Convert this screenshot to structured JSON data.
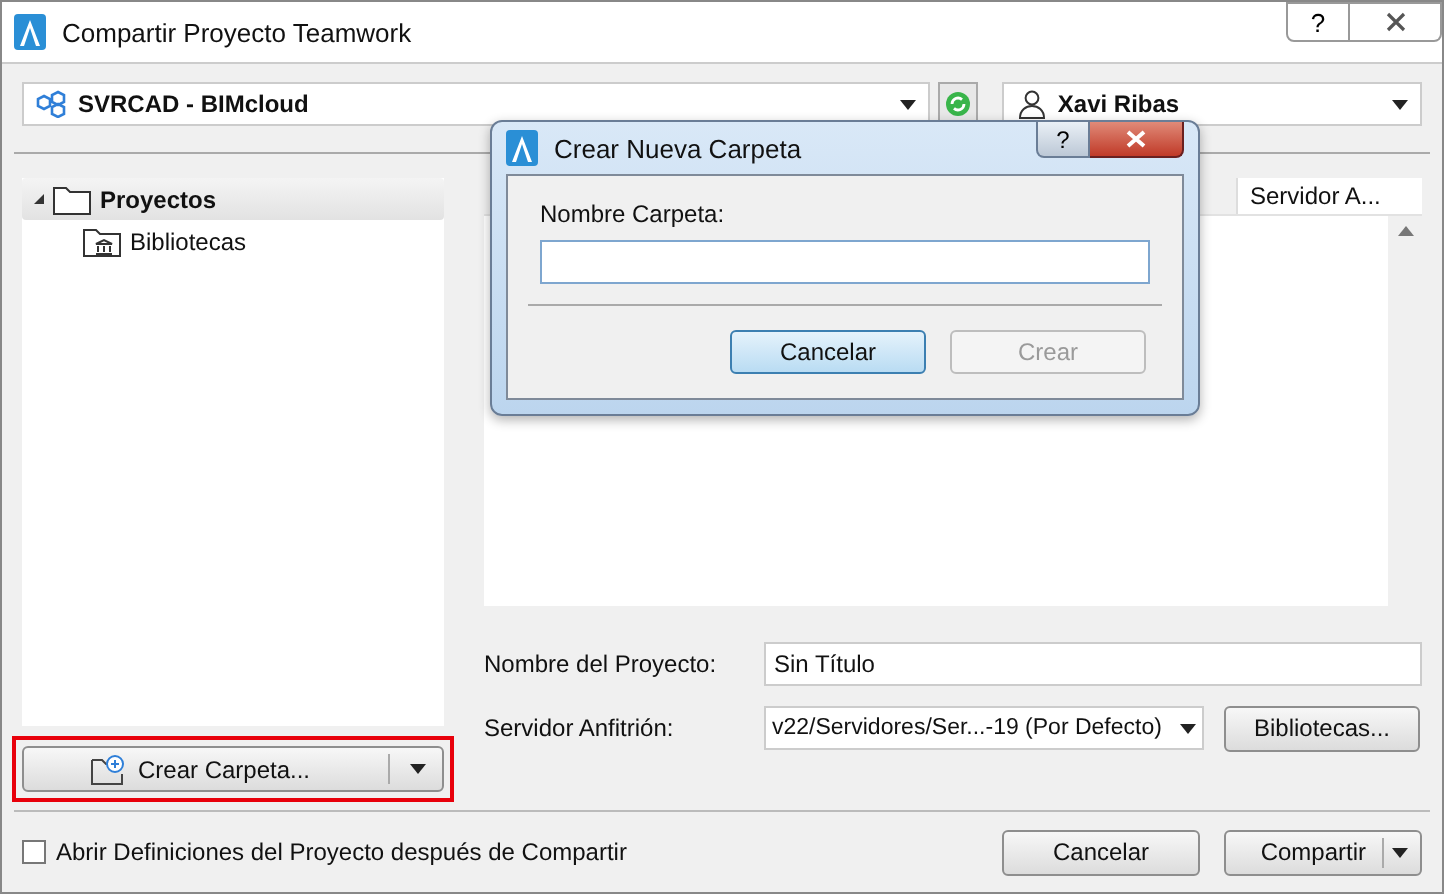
{
  "window": {
    "title": "Compartir Proyecto Teamwork",
    "help": "?"
  },
  "server": {
    "name": "SVRCAD - BIMcloud"
  },
  "user": {
    "name": "Xavi Ribas"
  },
  "tree": [
    {
      "label": "Proyectos",
      "selected": true,
      "expanded": true,
      "children": [
        {
          "label": "Bibliotecas",
          "selected": false
        }
      ]
    }
  ],
  "list": {
    "columns": [
      "Servidor A..."
    ]
  },
  "fields": [
    {
      "kind": "text",
      "label": "Nombre del Proyecto:",
      "value": "Sin Título"
    },
    {
      "kind": "dropdown",
      "label": "Servidor Anfitrión:",
      "value": "v22/Servidores/Ser...-19 (Por Defecto)",
      "button": "Bibliotecas..."
    }
  ],
  "create_folder": {
    "label": "Crear Carpeta...",
    "highlighted": true
  },
  "open_settings": {
    "label": "Abrir Definiciones del Proyecto después de Compartir",
    "checked": false
  },
  "buttons": [
    {
      "kind": "plain",
      "label": "Cancelar"
    },
    {
      "kind": "split",
      "label": "Compartir"
    }
  ],
  "dialog": {
    "title": "Crear Nueva Carpeta",
    "help": "?",
    "field_label": "Nombre Carpeta:",
    "buttons": [
      {
        "label": "Cancelar",
        "default": true,
        "disabled": false
      },
      {
        "label": "Crear",
        "default": false,
        "disabled": true
      }
    ]
  }
}
